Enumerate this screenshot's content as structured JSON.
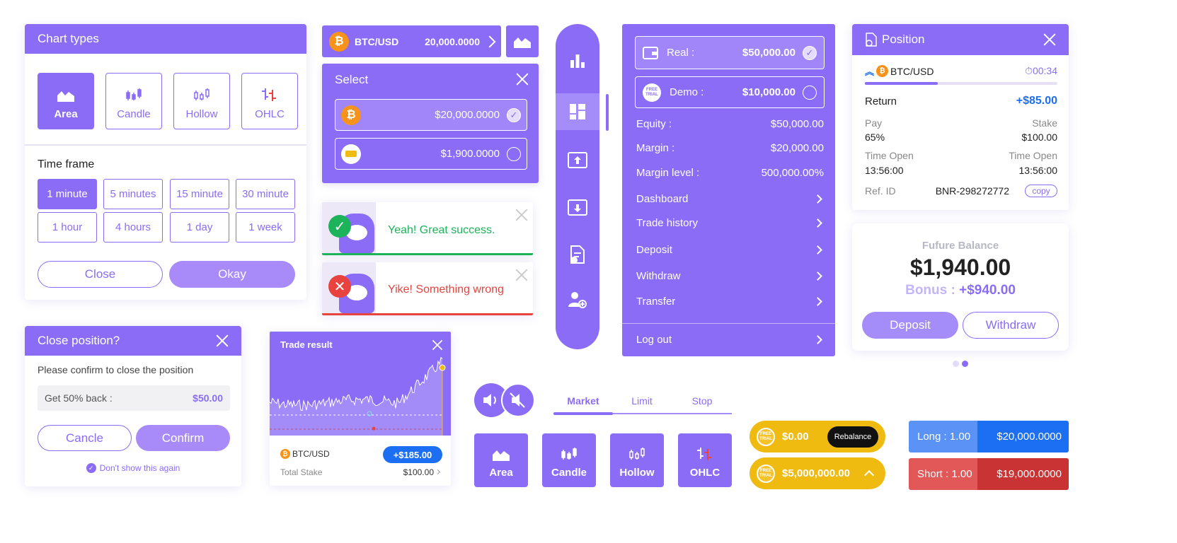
{
  "chart_types": {
    "title": "Chart types",
    "types": [
      {
        "label": "Area",
        "icon": "area-chart-icon"
      },
      {
        "label": "Candle",
        "icon": "candle-chart-icon"
      },
      {
        "label": "Hollow",
        "icon": "hollow-candle-icon"
      },
      {
        "label": "OHLC",
        "icon": "ohlc-chart-icon"
      }
    ],
    "selected": "Area",
    "time_frame_title": "Time frame",
    "time_frames": [
      "1 minute",
      "5 minutes",
      "15 minute",
      "30 minute",
      "1 hour",
      "4 hours",
      "1 day",
      "1 week"
    ],
    "selected_tf": "1 minute",
    "close_label": "Close",
    "okay_label": "Okay"
  },
  "pair_bar": {
    "pair": "BTC/USD",
    "price": "20,000.0000",
    "coin_icon": "btc-icon"
  },
  "select": {
    "title": "Select",
    "options": [
      {
        "value": "$20,000.0000",
        "icon": "btc-icon",
        "checked": true
      },
      {
        "value": "$1,900.0000",
        "icon": "gold-icon",
        "checked": false
      }
    ]
  },
  "toasts": {
    "success": "Yeah! Great success.",
    "error": "Yike! Something wrong",
    "success_color": "#1db35b",
    "error_color": "#e8433f"
  },
  "sidebar_icons": [
    "bar-chart-icon",
    "dashboard-icon",
    "deposit-icon",
    "withdraw-icon",
    "document-icon",
    "add-user-icon"
  ],
  "account": {
    "real_label": "Real :",
    "real_value": "$50,000.00",
    "demo_label": "Demo :",
    "demo_value": "$10,000.00",
    "demo_badge": "FREE TRIAL",
    "equity_label": "Equity :",
    "equity": "$50,000.00",
    "margin_label": "Margin :",
    "margin": "$20,000.00",
    "margin_level_label": "Margin level :",
    "margin_level": "500,000.00%",
    "menu": [
      "Dashboard",
      "Trade history",
      "Deposit",
      "Withdraw",
      "Transfer"
    ],
    "logout": "Log out"
  },
  "position": {
    "title": "Position",
    "pair": "BTC/USD",
    "timer": "00:34",
    "progress": 0.38,
    "return_label": "Return",
    "return_value": "+$85.00",
    "pay_label": "Pay",
    "pay_value": "65%",
    "stake_label": "Stake",
    "stake_value": "$100.00",
    "time_open_label": "Time Open",
    "time_open_left": "13:56:00",
    "time_open_right_label": "Time Open",
    "time_open_right": "13:56:00",
    "ref_label": "Ref. ID",
    "ref_value": "BNR-298272772",
    "copy_label": "copy"
  },
  "balance": {
    "title": "Fufure Balance",
    "amount": "$1,940.00",
    "bonus_label": "Bonus :",
    "bonus_value": "+$940.00",
    "deposit": "Deposit",
    "withdraw": "Withdraw"
  },
  "close_position": {
    "title": "Close position?",
    "message": "Please confirm to close the position",
    "get_back_label": "Get 50% back :",
    "get_back_value": "$50.00",
    "cancel": "Cancle",
    "confirm": "Confirm",
    "dont_show": "Don't show this again"
  },
  "trade_result": {
    "title": "Trade result",
    "pair": "BTC/USD",
    "result": "+$185.00",
    "stake_label": "Total Stake",
    "stake_value": "$100.00"
  },
  "order_tabs": {
    "tabs": [
      "Market",
      "Limit",
      "Stop"
    ],
    "active": "Market"
  },
  "demo_pills": {
    "balance": "$0.00",
    "rebalance": "Rebalance",
    "big_balance": "$5,000,000.00"
  },
  "long_short": {
    "long_label": "Long : 1.00",
    "long_value": "$20,000.0000",
    "short_label": "Short : 1.00",
    "short_value": "$19,000.0000"
  },
  "colors": {
    "accent": "#8b6cf7",
    "long": "#1c6ef2",
    "short": "#cc3333",
    "gold": "#f0bb10"
  }
}
